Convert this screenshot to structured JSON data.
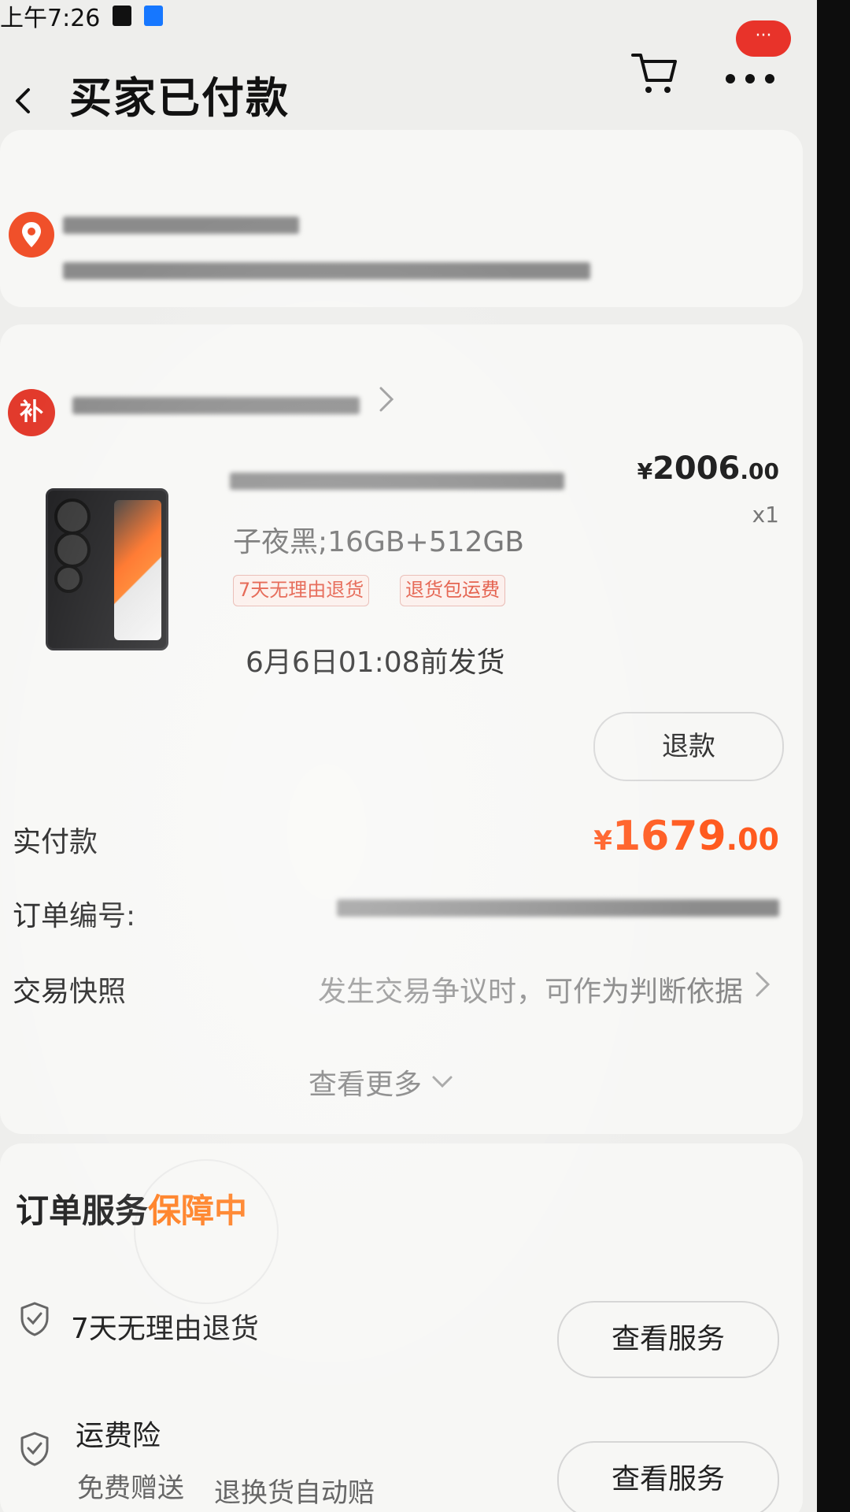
{
  "status_bar": {
    "time": "上午7:26",
    "icons": [
      "trash-icon",
      "alipay-icon"
    ]
  },
  "nav": {
    "title": "买家已付款",
    "back_icon": "chevron-left-icon",
    "cart_icon": "cart-icon",
    "more_icon": "more-dots-icon",
    "more_badge": "···"
  },
  "address": {
    "icon": "location-pin-icon"
  },
  "order": {
    "shop_badge": "补",
    "product": {
      "sku": "子夜黑;16GB+512GB",
      "price_symbol": "¥",
      "price_int": "2006",
      "price_dec": ".00",
      "quantity": "x1",
      "tags": [
        "7天无理由退货",
        "退货包运费"
      ],
      "ship_time": "6月6日01:08前发货"
    },
    "refund_label": "退款",
    "paid_label": "实付款",
    "paid_symbol": "¥",
    "paid_int": "1679",
    "paid_dec": ".00",
    "order_no_label": "订单编号:",
    "snapshot_label": "交易快照",
    "snapshot_desc": "发生交易争议时，可作为判断依据",
    "see_more": "查看更多"
  },
  "service": {
    "title_main": "订单服务",
    "title_accent": "保障中",
    "items": [
      {
        "label": "7天无理由退货",
        "button": "查看服务"
      },
      {
        "label": "运费险",
        "sub1": "免费赠送",
        "sub2": "退换货自动赔",
        "button": "查看服务"
      }
    ]
  },
  "colors": {
    "accent_orange": "#ff5a1f",
    "badge_red": "#e23a2c",
    "tag_red": "#e0462f"
  }
}
